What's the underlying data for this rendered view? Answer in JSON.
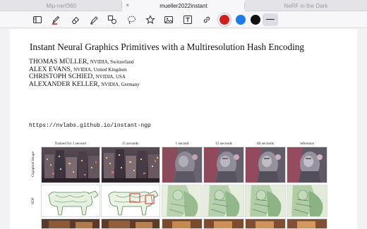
{
  "tabs": [
    {
      "label": "Mip-nerf360",
      "active": false
    },
    {
      "label": "mueller2022instant",
      "active": true,
      "close_glyph": "×"
    },
    {
      "label": "NeRF in the Dark",
      "active": false
    }
  ],
  "toolbar": {
    "tools": [
      "sidebar-icon",
      "pen-icon",
      "eraser-icon",
      "highlighter-icon",
      "shapes-icon",
      "lasso-icon",
      "star-icon",
      "image-icon",
      "text-icon",
      "link-icon"
    ],
    "colors": [
      "#d21e1e",
      "#1e7be6",
      "#111111"
    ],
    "selected_color": "#d21e1e"
  },
  "paper": {
    "title": "Instant Neural Graphics Primitives with a Multiresolution Hash Encoding",
    "authors": [
      {
        "name": "THOMAS MÜLLER,",
        "affiliation": "NVIDIA, Switzerland"
      },
      {
        "name": "ALEX EVANS,",
        "affiliation": "NVIDIA, United Kingdom"
      },
      {
        "name": "CHRISTOPH SCHIED,",
        "affiliation": "NVIDIA, USA"
      },
      {
        "name": "ALEXANDER KELLER,",
        "affiliation": "NVIDIA, Germany"
      }
    ],
    "url": "https://nvlabs.github.io/instant-ngp"
  },
  "figure": {
    "columns": [
      "Trained for 1 second",
      "15 seconds",
      "1 second",
      "15 seconds",
      "60 seconds",
      "reference"
    ],
    "rows": [
      "Gigapixel image",
      "SDF"
    ]
  }
}
